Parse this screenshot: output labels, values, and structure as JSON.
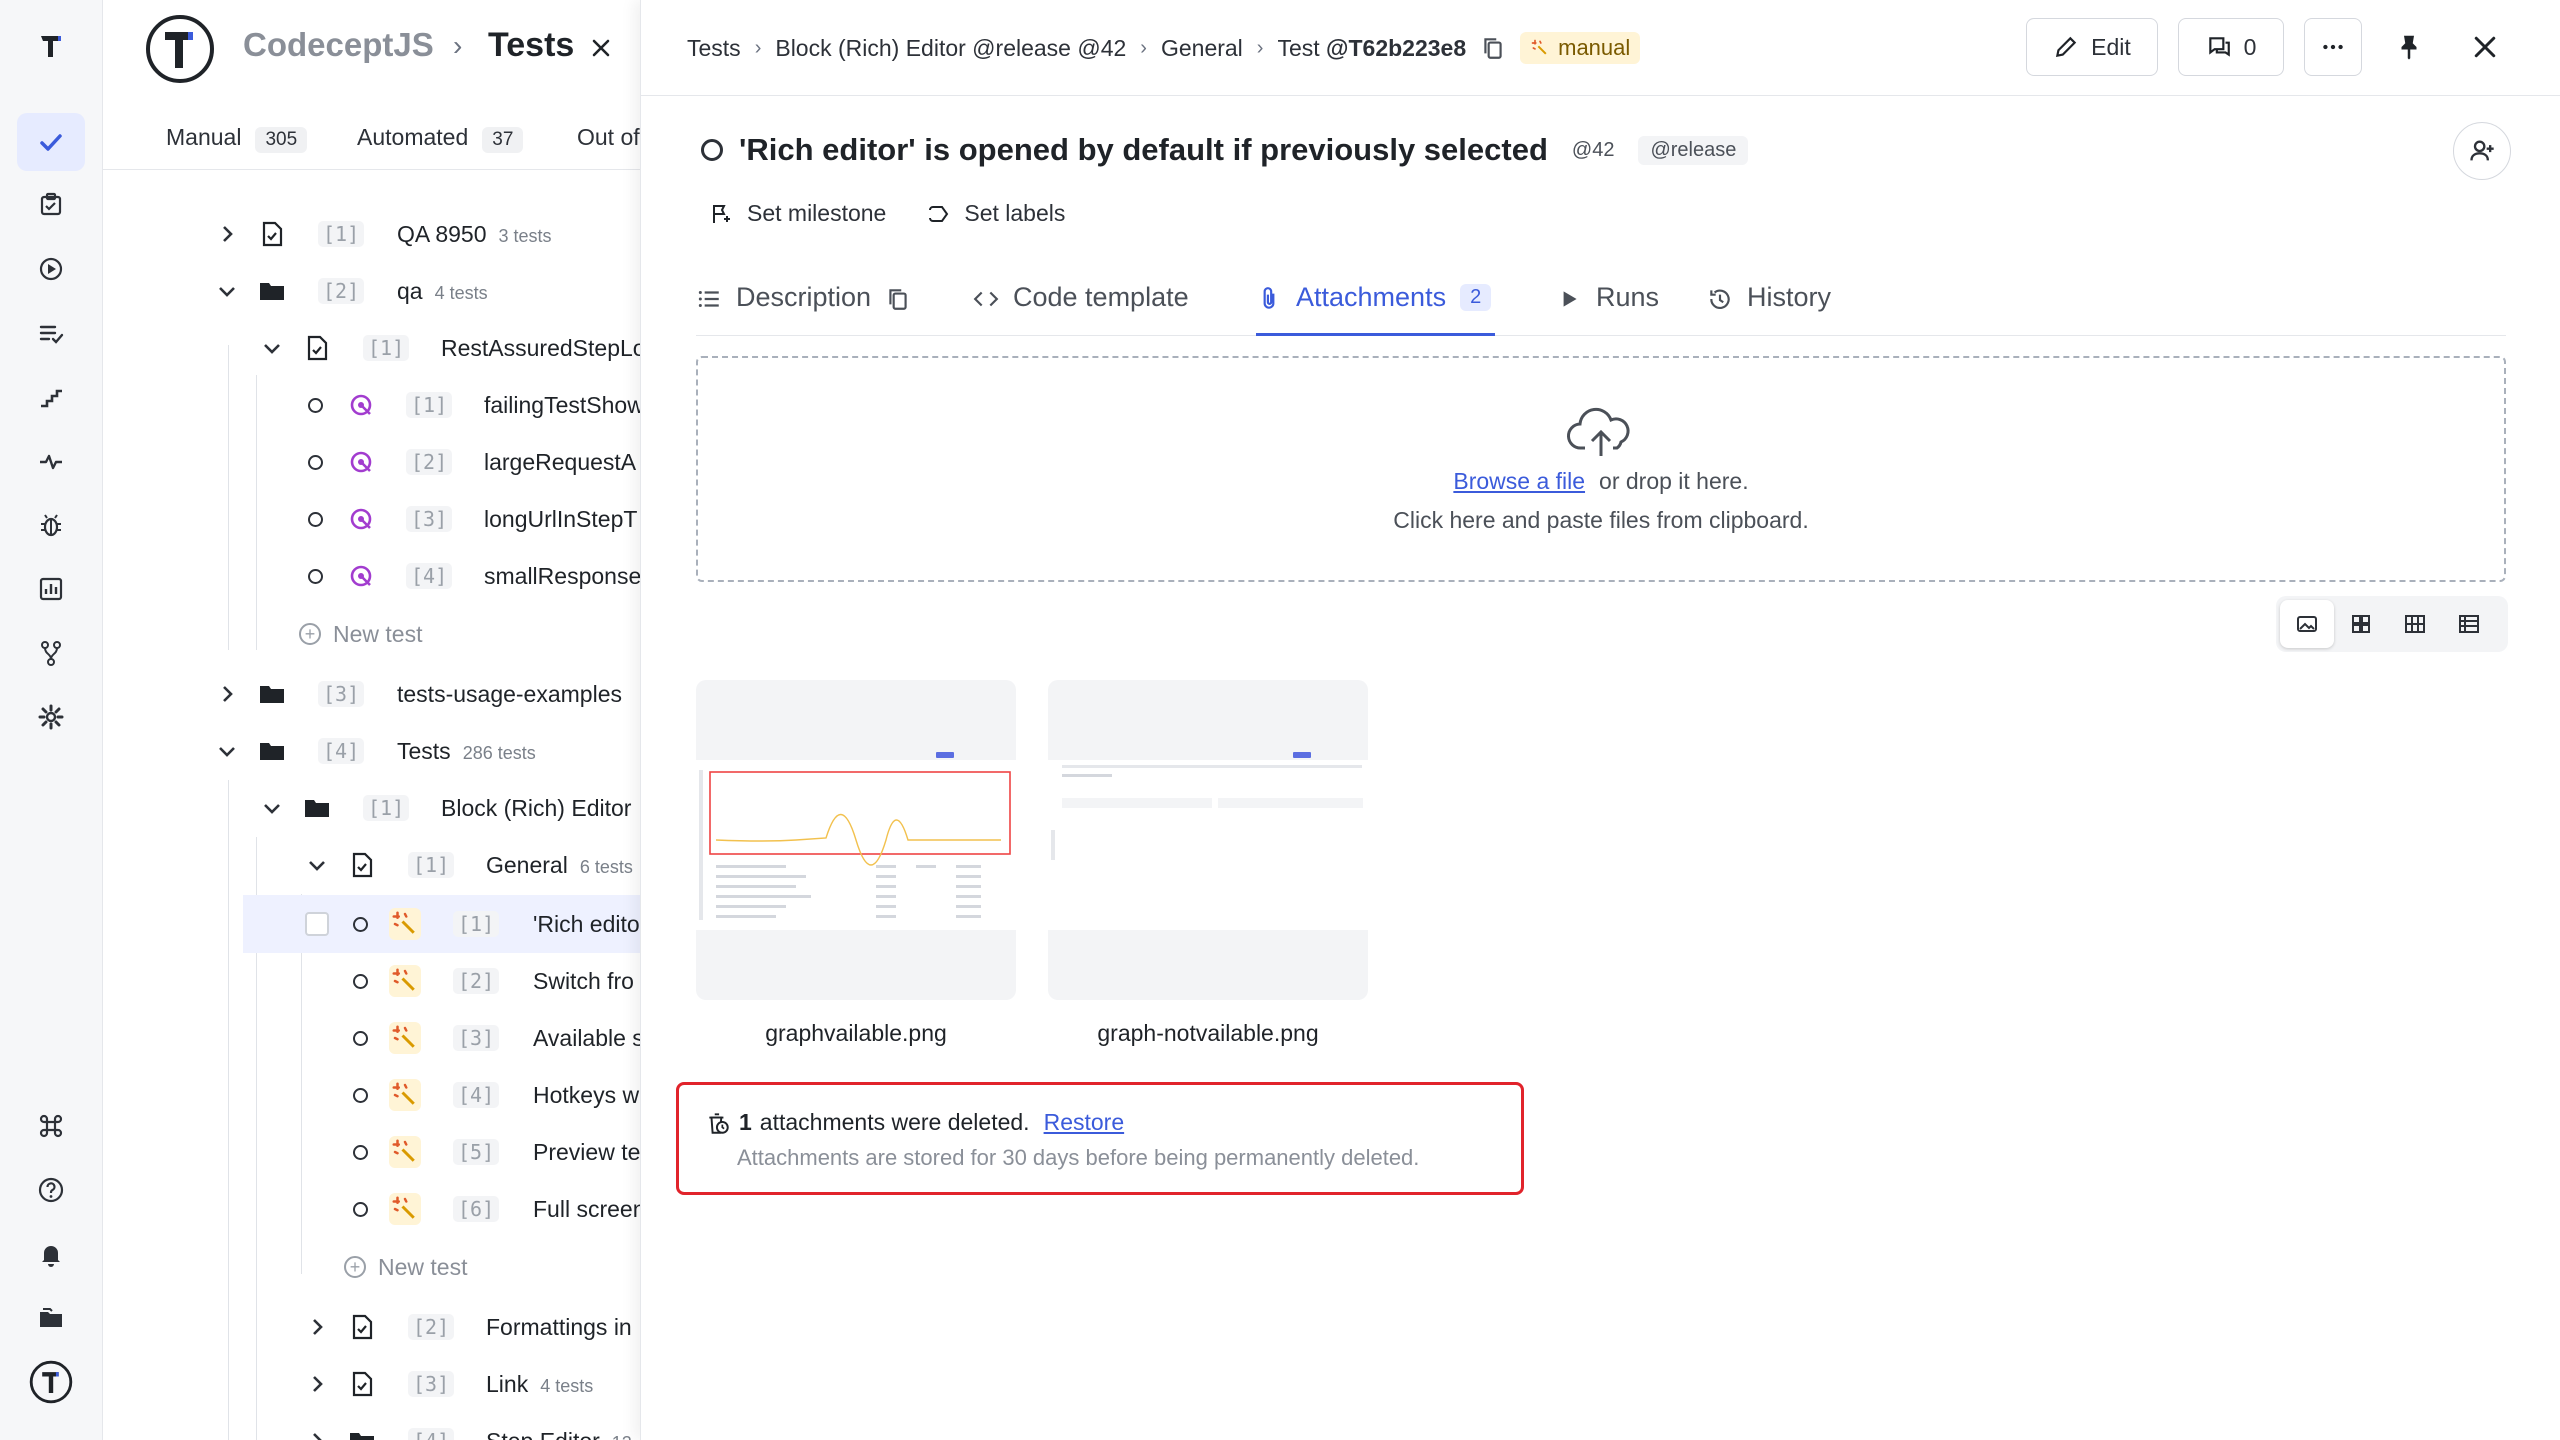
{
  "app": {
    "brand": "CodeceptJS",
    "page": "Tests"
  },
  "tree_tabs": [
    {
      "label": "Manual",
      "count": "305"
    },
    {
      "label": "Automated",
      "count": "37"
    },
    {
      "label": "Out of",
      "count": ""
    }
  ],
  "tree": {
    "rows": [
      {
        "idx": "[1]",
        "label": "QA 8950",
        "sub": "3 tests"
      },
      {
        "idx": "[2]",
        "label": "qa",
        "sub": "4 tests"
      },
      {
        "idx": "[1]",
        "label": "RestAssuredStepLo",
        "sub": ""
      },
      {
        "idx": "[1]",
        "label": "failingTestShow",
        "sub": ""
      },
      {
        "idx": "[2]",
        "label": "largeRequestA",
        "sub": ""
      },
      {
        "idx": "[3]",
        "label": "longUrlInStepT",
        "sub": ""
      },
      {
        "idx": "[4]",
        "label": "smallResponse",
        "sub": ""
      },
      {
        "idx": "[3]",
        "label": "tests-usage-examples",
        "sub": ""
      },
      {
        "idx": "[4]",
        "label": "Tests",
        "sub": "286 tests"
      },
      {
        "idx": "[1]",
        "label": "Block (Rich) Editor",
        "sub": ""
      },
      {
        "idx": "[1]",
        "label": "General",
        "sub": "6 tests"
      },
      {
        "idx": "[1]",
        "label": "'Rich edito",
        "sub": ""
      },
      {
        "idx": "[2]",
        "label": "Switch fro",
        "sub": ""
      },
      {
        "idx": "[3]",
        "label": "Available s",
        "sub": ""
      },
      {
        "idx": "[4]",
        "label": "Hotkeys w",
        "sub": ""
      },
      {
        "idx": "[5]",
        "label": "Preview te",
        "sub": ""
      },
      {
        "idx": "[6]",
        "label": "Full screen",
        "sub": ""
      },
      {
        "idx": "[2]",
        "label": "Formattings in",
        "sub": ""
      },
      {
        "idx": "[3]",
        "label": "Link",
        "sub": "4 tests"
      },
      {
        "idx": "[4]",
        "label": "Step Editor",
        "sub": "12"
      }
    ],
    "new_test_label": "New test"
  },
  "breadcrumb": {
    "items": [
      "Tests",
      "Block (Rich) Editor @release @42",
      "General"
    ],
    "test_prefix": "Test",
    "test_id": "@T62b223e8",
    "badge": "manual"
  },
  "toolbar": {
    "edit_label": "Edit",
    "comments_count": "0"
  },
  "test": {
    "title": "'Rich editor' is opened by default if previously selected",
    "tags": [
      "@42",
      "@release"
    ],
    "set_milestone": "Set milestone",
    "set_labels": "Set labels"
  },
  "tabs": [
    {
      "label": "Description"
    },
    {
      "label": "Code template"
    },
    {
      "label": "Attachments",
      "count": "2"
    },
    {
      "label": "Runs"
    },
    {
      "label": "History"
    }
  ],
  "dropzone": {
    "browse": "Browse a file",
    "or_drop": "or drop it here.",
    "paste": "Click here and paste files from clipboard."
  },
  "attachments": [
    {
      "name": "graphvailable.png"
    },
    {
      "name": "graph-notvailable.png"
    }
  ],
  "deleted_notice": {
    "count": "1",
    "text": "attachments were deleted.",
    "restore": "Restore",
    "note": "Attachments are stored for 30 days before being permanently deleted."
  },
  "colors": {
    "accent": "#3b5bdb",
    "highlight_border": "#e1232b",
    "manual_badge_bg": "#fff4d6"
  }
}
